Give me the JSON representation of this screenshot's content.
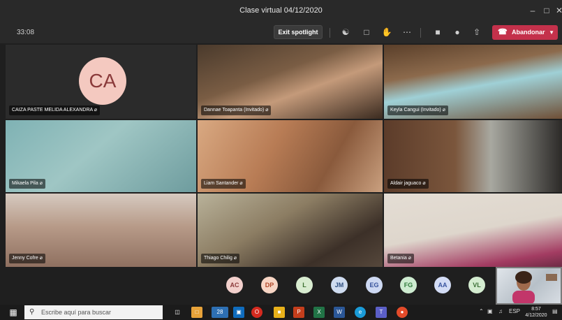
{
  "window": {
    "title": "Clase virtual 04/12/2020"
  },
  "toolbar": {
    "timer": "33:08",
    "exit_spotlight_label": "Exit spotlight",
    "leave_label": "Abandonar"
  },
  "participants_video": [
    {
      "name": "CAIZA PASTE MELIDA ALEXANDRA",
      "initials": "CA"
    },
    {
      "name": "Dannae Toapanta (Invitado)"
    },
    {
      "name": "Keyla Cangui (Invitado)"
    },
    {
      "name": "Mikaela Pila"
    },
    {
      "name": "Liam Santander"
    },
    {
      "name": "Aldair jaguaco"
    },
    {
      "name": "Jenny Cofre"
    },
    {
      "name": "Thiago Chilig"
    },
    {
      "name": "Betania"
    }
  ],
  "participants_audio": [
    {
      "initials": "AC",
      "bg": "#f2d0cc",
      "fg": "#8b3a3a"
    },
    {
      "initials": "DP",
      "bg": "#f7d5c4",
      "fg": "#b0482a"
    },
    {
      "initials": "L",
      "bg": "#d8ecd0",
      "fg": "#3b6e30"
    },
    {
      "initials": "JM",
      "bg": "#cfdcf0",
      "fg": "#2f4f80"
    },
    {
      "initials": "EG",
      "bg": "#cdd8f2",
      "fg": "#35509a"
    },
    {
      "initials": "FG",
      "bg": "#cdebd0",
      "fg": "#2f7a3b"
    },
    {
      "initials": "AA",
      "bg": "#d3dcf5",
      "fg": "#3a55a0"
    },
    {
      "initials": "VL",
      "bg": "#d4ecd0",
      "fg": "#3a6e35"
    }
  ],
  "taskbar": {
    "search_placeholder": "Escribe aquí para buscar",
    "weather_temp": "28",
    "language": "ESP",
    "time": "8:57",
    "date": "4/12/2020"
  },
  "colors": {
    "leave": "#c4314b",
    "titlebar": "#292929",
    "stage": "#1f1f1f"
  }
}
